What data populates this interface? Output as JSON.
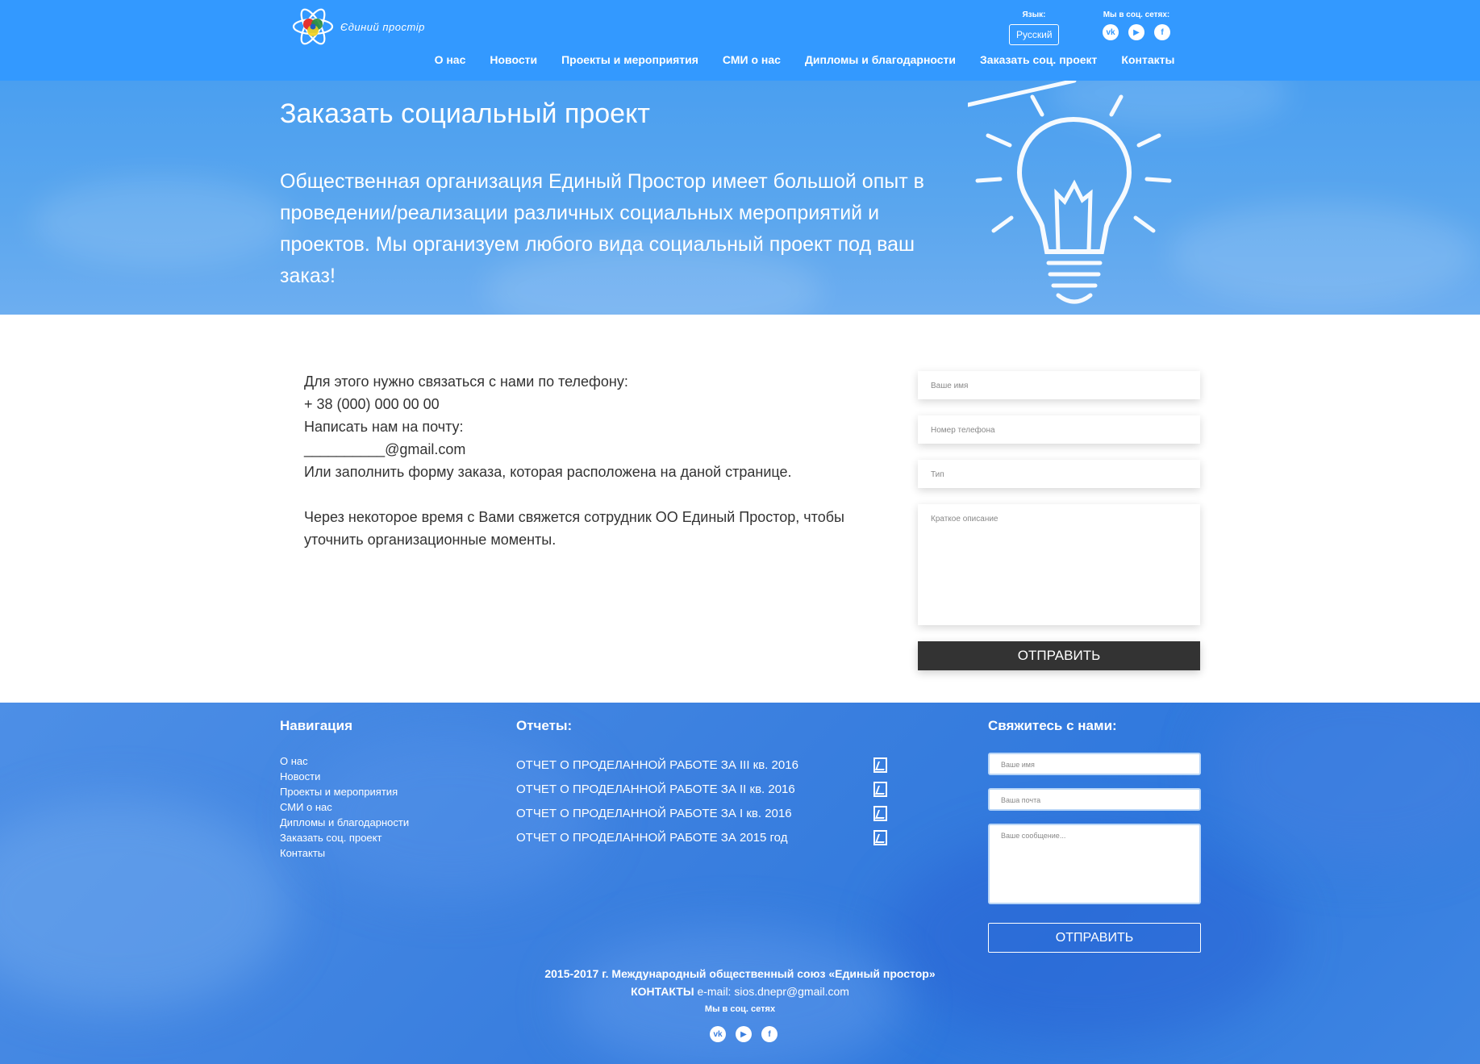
{
  "header": {
    "logo_text": "Єдиний простір",
    "lang_label": "Язык:",
    "lang_value": "Русский",
    "social_label": "Мы в соц. сетях:",
    "social_icons": [
      {
        "name": "vk-icon",
        "glyph": "vk"
      },
      {
        "name": "youtube-icon",
        "glyph": "▶"
      },
      {
        "name": "facebook-icon",
        "glyph": "f"
      }
    ],
    "nav": [
      "О нас",
      "Новости",
      "Проекты и мероприятия",
      "СМИ о нас",
      "Дипломы и благодарности",
      "Заказать соц. проект",
      "Контакты"
    ]
  },
  "hero": {
    "title": "Заказать социальный проект",
    "text": "Общественная организация Единый Простор имеет большой опыт в проведении/реализации различных социальных мероприятий и проектов. Мы организуем любого вида социальный проект под ваш заказ!"
  },
  "main": {
    "lines": [
      "Для этого нужно связаться с нами по телефону:",
      "+ 38 (000) 000 00 00",
      "Написать нам на почту:",
      "__________@gmail.com",
      "Или заполнить форму заказа, которая расположена на даной странице."
    ],
    "note": "Через некоторое время с Вами свяжется сотрудник ОО Единый Простор, чтобы уточнить организационные моменты."
  },
  "order_form": {
    "name_placeholder": "Ваше имя",
    "phone_placeholder": "Номер телефона",
    "type_placeholder": "Тип",
    "desc_placeholder": "Краткое описание",
    "submit_label": "ОТПРАВИТЬ"
  },
  "footer": {
    "nav_title": "Навигация",
    "nav": [
      "О нас",
      "Новости",
      "Проекты и мероприятия",
      "СМИ о нас",
      "Дипломы и благодарности",
      "Заказать соц. проект",
      "Контакты"
    ],
    "reports_title": "Отчеты:",
    "reports": [
      "ОТЧЕТ О ПРОДЕЛАННОЙ РАБОТЕ ЗА III кв. 2016",
      "ОТЧЕТ О ПРОДЕЛАННОЙ РАБОТЕ ЗА II кв. 2016",
      "ОТЧЕТ О ПРОДЕЛАННОЙ РАБОТЕ ЗА I кв. 2016",
      "ОТЧЕТ О ПРОДЕЛАННОЙ РАБОТЕ ЗА 2015 год"
    ],
    "contact_title": "Свяжитесь с нами:",
    "contact_form": {
      "name_placeholder": "Ваше имя",
      "email_placeholder": "Ваша почта",
      "message_placeholder": "Ваше сообщение...",
      "submit_label": "ОТПРАВИТЬ"
    },
    "copyright": "2015-2017 г. Международный общественный союз «Единый простор»",
    "contacts_label": "КОНТАКТЫ",
    "contacts_email": "e-mail: sios.dnepr@gmail.com",
    "social_label": "Мы в соц. сетях"
  },
  "colors": {
    "header_bg": "#3399ff",
    "button_dark": "#333333",
    "footer_bg": "#3a7fdf"
  }
}
